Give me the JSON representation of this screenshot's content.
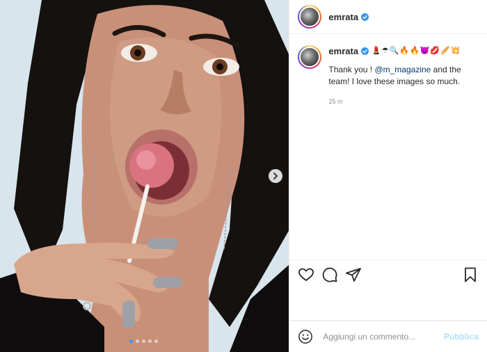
{
  "header": {
    "username": "emrata"
  },
  "caption": {
    "username": "emrata",
    "emojis": "💄☂🔍🔥🔥😈💋🥖💥",
    "text_before": "Thank you ! ",
    "mention": "@m_magazine",
    "text_after": " and the team! I love these images so much.",
    "time": "25 m"
  },
  "comment": {
    "placeholder": "Aggiungi un commento...",
    "publish_label": "Pubblica"
  },
  "carousel": {
    "total": 5,
    "active_index": 0
  },
  "colors": {
    "verified": "#3897f0",
    "mention": "#00376b",
    "publish": "#b2dffc"
  }
}
